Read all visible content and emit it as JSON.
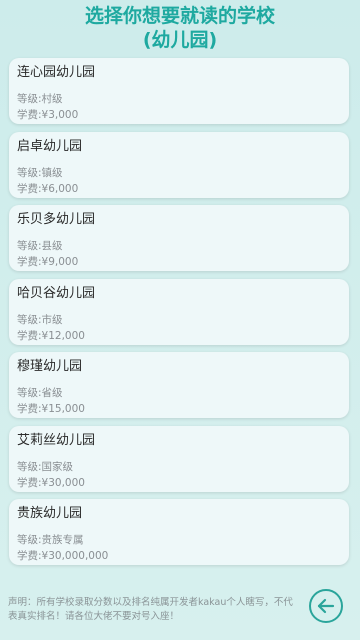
{
  "header": {
    "title_line1": "选择你想要就读的学校",
    "title_line2": "(幼儿园)"
  },
  "schools": [
    {
      "name": "连心园幼儿园",
      "level_label": "等级: ",
      "level": "村级",
      "fee_label": "学费: ",
      "fee": "¥3,000"
    },
    {
      "name": "启卓幼儿园",
      "level_label": "等级: ",
      "level": "镇级",
      "fee_label": "学费: ",
      "fee": "¥6,000"
    },
    {
      "name": "乐贝多幼儿园",
      "level_label": "等级: ",
      "level": "县级",
      "fee_label": "学费: ",
      "fee": "¥9,000"
    },
    {
      "name": "哈贝谷幼儿园",
      "level_label": "等级: ",
      "level": "市级",
      "fee_label": "学费: ",
      "fee": "¥12,000"
    },
    {
      "name": "穆瑾幼儿园",
      "level_label": "等级: ",
      "level": "省级",
      "fee_label": "学费: ",
      "fee": "¥15,000"
    },
    {
      "name": "艾莉丝幼儿园",
      "level_label": "等级: ",
      "level": "国家级",
      "fee_label": "学费: ",
      "fee": "¥30,000"
    },
    {
      "name": "贵族幼儿园",
      "level_label": "等级: ",
      "level": "贵族专属",
      "fee_label": "学费: ",
      "fee": "¥30,000,000"
    }
  ],
  "footer": {
    "disclaimer": "声明：所有学校录取分数以及排名纯属开发者kakau个人瞎写，不代表真实排名！请各位大佬不要对号入座！"
  },
  "icons": {
    "back": "arrow-left-icon"
  },
  "colors": {
    "accent": "#1ea9a0",
    "background": "#d2eeec",
    "card": "#eef8f9"
  }
}
